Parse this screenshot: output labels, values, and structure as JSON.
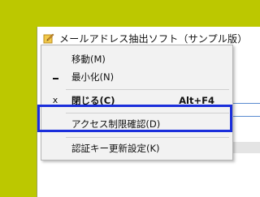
{
  "window": {
    "title": "メールアドレス抽出ソフト（サンプル版）",
    "app_icon": "pencil-note-icon"
  },
  "system_menu": {
    "items": [
      {
        "label": "移動(M)",
        "shortcut": "",
        "icon": ""
      },
      {
        "label": "最小化(N)",
        "shortcut": "",
        "icon": "minimize-icon"
      },
      {
        "label": "閉じる(C)",
        "shortcut": "Alt+F4",
        "icon": "close-icon",
        "close_glyph": "x"
      },
      {
        "label": "アクセス制限確認(D)",
        "shortcut": "",
        "icon": ""
      },
      {
        "label": "認証キー更新設定(K)",
        "shortcut": "",
        "icon": ""
      }
    ]
  },
  "colors": {
    "desktop": "#bcc800",
    "highlight": "#1a2edb",
    "menu_bg": "#f2f2f2"
  }
}
